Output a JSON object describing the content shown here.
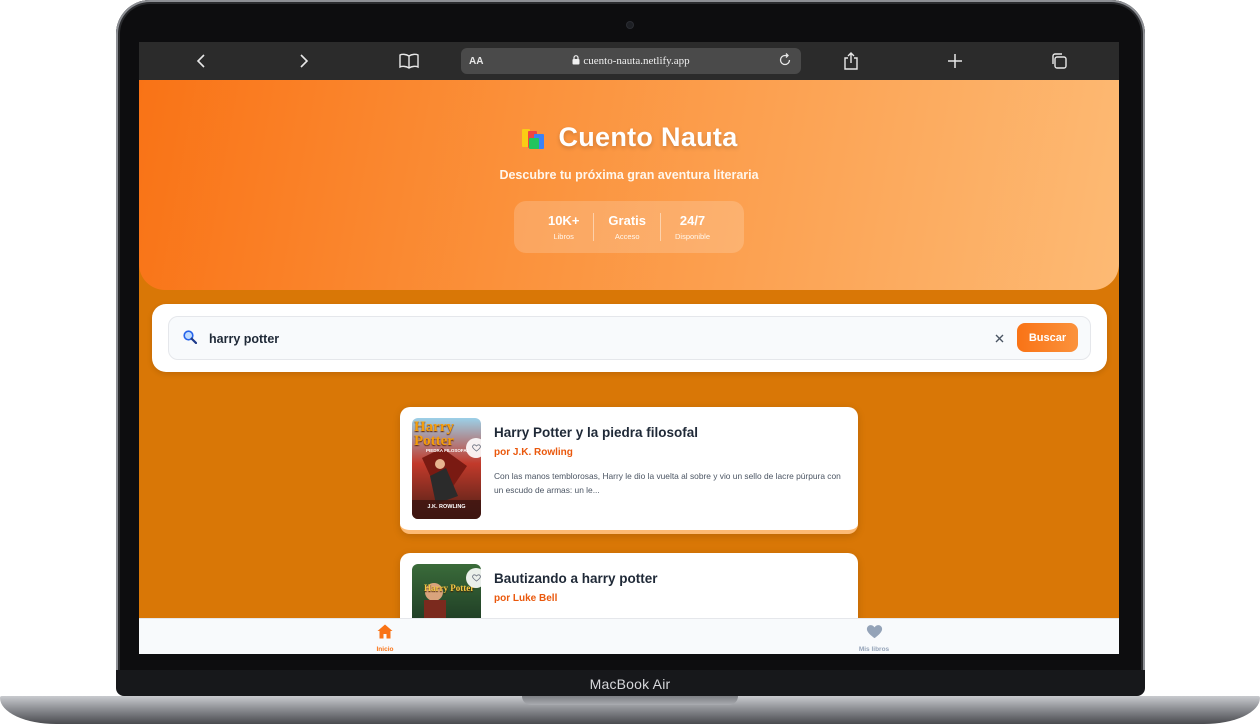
{
  "device": {
    "model": "MacBook Air"
  },
  "browser": {
    "text_size_label": "AA",
    "url": "cuento-nauta.netlify.app"
  },
  "hero": {
    "title": "Cuento Nauta",
    "subtitle": "Descubre tu próxima gran aventura literaria",
    "stats": [
      {
        "value": "10K+",
        "label": "Libros"
      },
      {
        "value": "Gratis",
        "label": "Acceso"
      },
      {
        "value": "24/7",
        "label": "Disponible"
      }
    ]
  },
  "search": {
    "value": "harry potter",
    "button_label": "Buscar"
  },
  "results": [
    {
      "title": "Harry Potter y la piedra filosofal",
      "author": "por J.K. Rowling",
      "description": "Con las manos temblorosas, Harry le dio la vuelta al sobre y vio un sello de lacre púrpura con un escudo de armas: un le...",
      "cover_text": "Harry Potter",
      "cover_sub": "PIEDRA FILOSOFAL",
      "cover_author": "J.K. ROWLING"
    },
    {
      "title": "Bautizando a harry potter",
      "author": "por Luke Bell",
      "cover_text": "Harry Potter"
    }
  ],
  "bottom_nav": [
    {
      "label": "Inicio",
      "icon": "home-icon",
      "active": true,
      "color": "#f97316"
    },
    {
      "label": "Mis libros",
      "icon": "heart-icon",
      "active": false,
      "color": "#94a3b8"
    }
  ],
  "colors": {
    "accent": "#f97316",
    "page_background": "#d97706"
  }
}
